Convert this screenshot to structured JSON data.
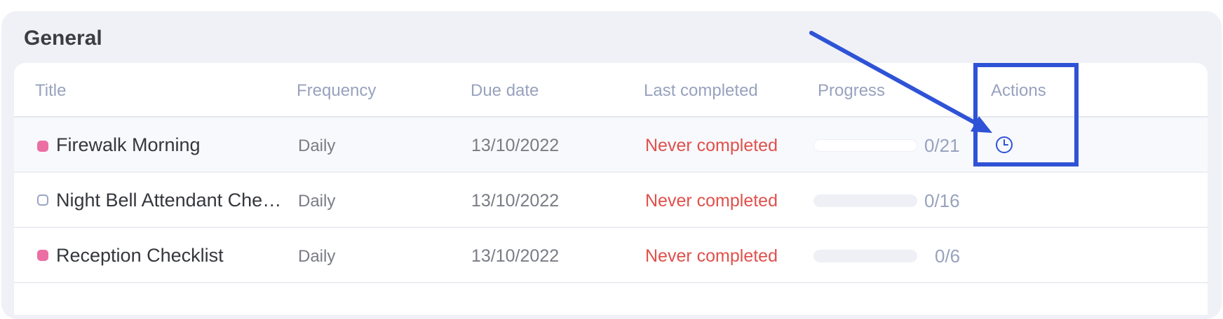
{
  "section": {
    "title": "General"
  },
  "columns": {
    "title": "Title",
    "frequency": "Frequency",
    "due_date": "Due date",
    "last_completed": "Last completed",
    "progress": "Progress",
    "actions": "Actions"
  },
  "rows": [
    {
      "title": "Firewalk Morning",
      "status_marker": "filled-pink",
      "frequency": "Daily",
      "due_date": "13/10/2022",
      "last_completed": "Never completed",
      "progress_label": "0/21",
      "progress_fraction": 0,
      "action_icon": "clock-icon"
    },
    {
      "title": "Night Bell Attendant Che…",
      "status_marker": "outline",
      "frequency": "Daily",
      "due_date": "13/10/2022",
      "last_completed": "Never completed",
      "progress_label": "0/16",
      "progress_fraction": 0
    },
    {
      "title": "Reception Checklist",
      "status_marker": "filled-pink",
      "frequency": "Daily",
      "due_date": "13/10/2022",
      "last_completed": "Never completed",
      "progress_label": "0/6",
      "progress_fraction": 0
    }
  ],
  "colors": {
    "accent": "#2f53d6",
    "never_completed": "#e0504b",
    "marker_pink": "#ec6fa4",
    "header_text": "#98a2be"
  }
}
